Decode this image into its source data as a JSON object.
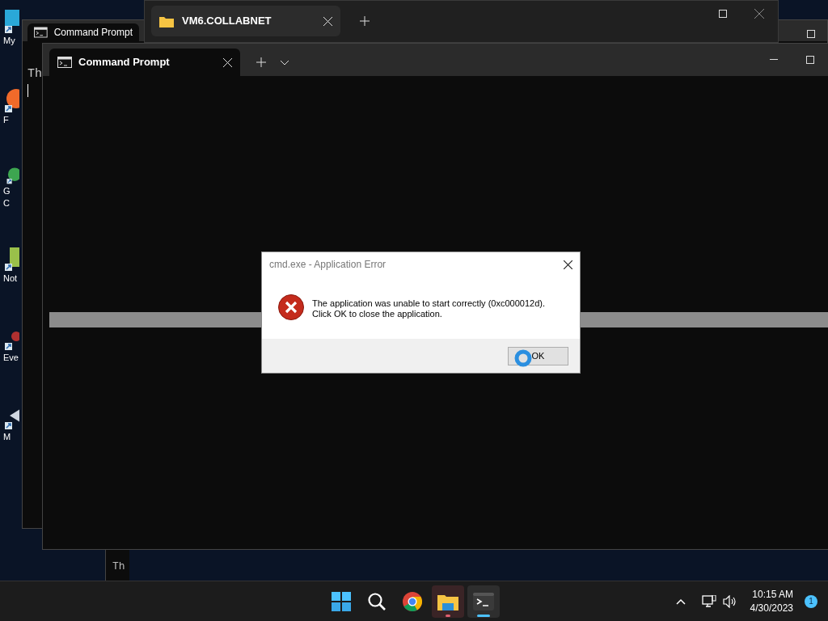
{
  "desktop_icons": [
    {
      "kind": "computer",
      "lines": [
        "My"
      ]
    },
    {
      "kind": "firefox",
      "lines": [
        "F"
      ]
    },
    {
      "kind": "chrome",
      "lines": [
        "G",
        "C"
      ]
    },
    {
      "kind": "notepad",
      "lines": [
        "Not"
      ]
    },
    {
      "kind": "shortcut",
      "lines": [
        "Eve"
      ]
    },
    {
      "kind": "media",
      "lines": [
        "M"
      ]
    }
  ],
  "explorer_window": {
    "tab": "VM6.COLLABNET"
  },
  "back_console": {
    "tab": "Command Prompt",
    "lines": [
      "Th"
    ]
  },
  "lower_console": {
    "lines": [
      "Th"
    ]
  },
  "front_console": {
    "tab": "Command Prompt"
  },
  "dialog": {
    "title": "cmd.exe - Application Error",
    "message": [
      "The application was unable to start correctly (0xc000012d).",
      "Click OK to close the application."
    ],
    "button": "OK"
  },
  "taskbar": {
    "apps": [
      {
        "kind": "start",
        "running": false,
        "focused": false
      },
      {
        "kind": "search",
        "running": false,
        "focused": false
      },
      {
        "kind": "chrome",
        "running": false,
        "focused": false
      },
      {
        "kind": "explorer",
        "running": true,
        "focused": false
      },
      {
        "kind": "terminal",
        "running": true,
        "focused": true
      }
    ],
    "time": "10:15 AM",
    "date": "4/30/2023",
    "notifications": "1"
  }
}
